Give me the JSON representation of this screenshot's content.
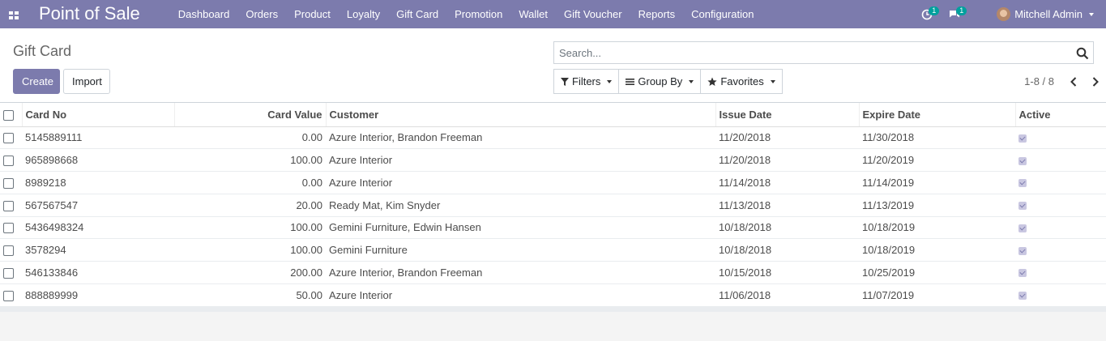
{
  "navbar": {
    "brand": "Point of Sale",
    "menu": [
      "Dashboard",
      "Orders",
      "Product",
      "Loyalty",
      "Gift Card",
      "Promotion",
      "Wallet",
      "Gift Voucher",
      "Reports",
      "Configuration"
    ],
    "activity_badge": "1",
    "messages_badge": "1",
    "user_name": "Mitchell Admin",
    "color": "#7c7bad"
  },
  "control_panel": {
    "title": "Gift Card",
    "create_label": "Create",
    "import_label": "Import",
    "search_placeholder": "Search...",
    "filters_label": "Filters",
    "groupby_label": "Group By",
    "favorites_label": "Favorites",
    "pager": "1-8 / 8"
  },
  "table": {
    "columns": [
      "Card No",
      "Card Value",
      "Customer",
      "Issue Date",
      "Expire Date",
      "Active"
    ],
    "rows": [
      {
        "card_no": "5145889111",
        "value": "0.00",
        "customer": "Azure Interior, Brandon Freeman",
        "issue": "11/20/2018",
        "expire": "11/30/2018",
        "active": true
      },
      {
        "card_no": "965898668",
        "value": "100.00",
        "customer": "Azure Interior",
        "issue": "11/20/2018",
        "expire": "11/20/2019",
        "active": true
      },
      {
        "card_no": "8989218",
        "value": "0.00",
        "customer": "Azure Interior",
        "issue": "11/14/2018",
        "expire": "11/14/2019",
        "active": true
      },
      {
        "card_no": "567567547",
        "value": "20.00",
        "customer": "Ready Mat, Kim Snyder",
        "issue": "11/13/2018",
        "expire": "11/13/2019",
        "active": true
      },
      {
        "card_no": "5436498324",
        "value": "100.00",
        "customer": "Gemini Furniture, Edwin Hansen",
        "issue": "10/18/2018",
        "expire": "10/18/2019",
        "active": true
      },
      {
        "card_no": "3578294",
        "value": "100.00",
        "customer": "Gemini Furniture",
        "issue": "10/18/2018",
        "expire": "10/18/2019",
        "active": true
      },
      {
        "card_no": "546133846",
        "value": "200.00",
        "customer": "Azure Interior, Brandon Freeman",
        "issue": "10/15/2018",
        "expire": "10/25/2019",
        "active": true
      },
      {
        "card_no": "888889999",
        "value": "50.00",
        "customer": "Azure Interior",
        "issue": "11/06/2018",
        "expire": "11/07/2019",
        "active": true
      }
    ]
  }
}
